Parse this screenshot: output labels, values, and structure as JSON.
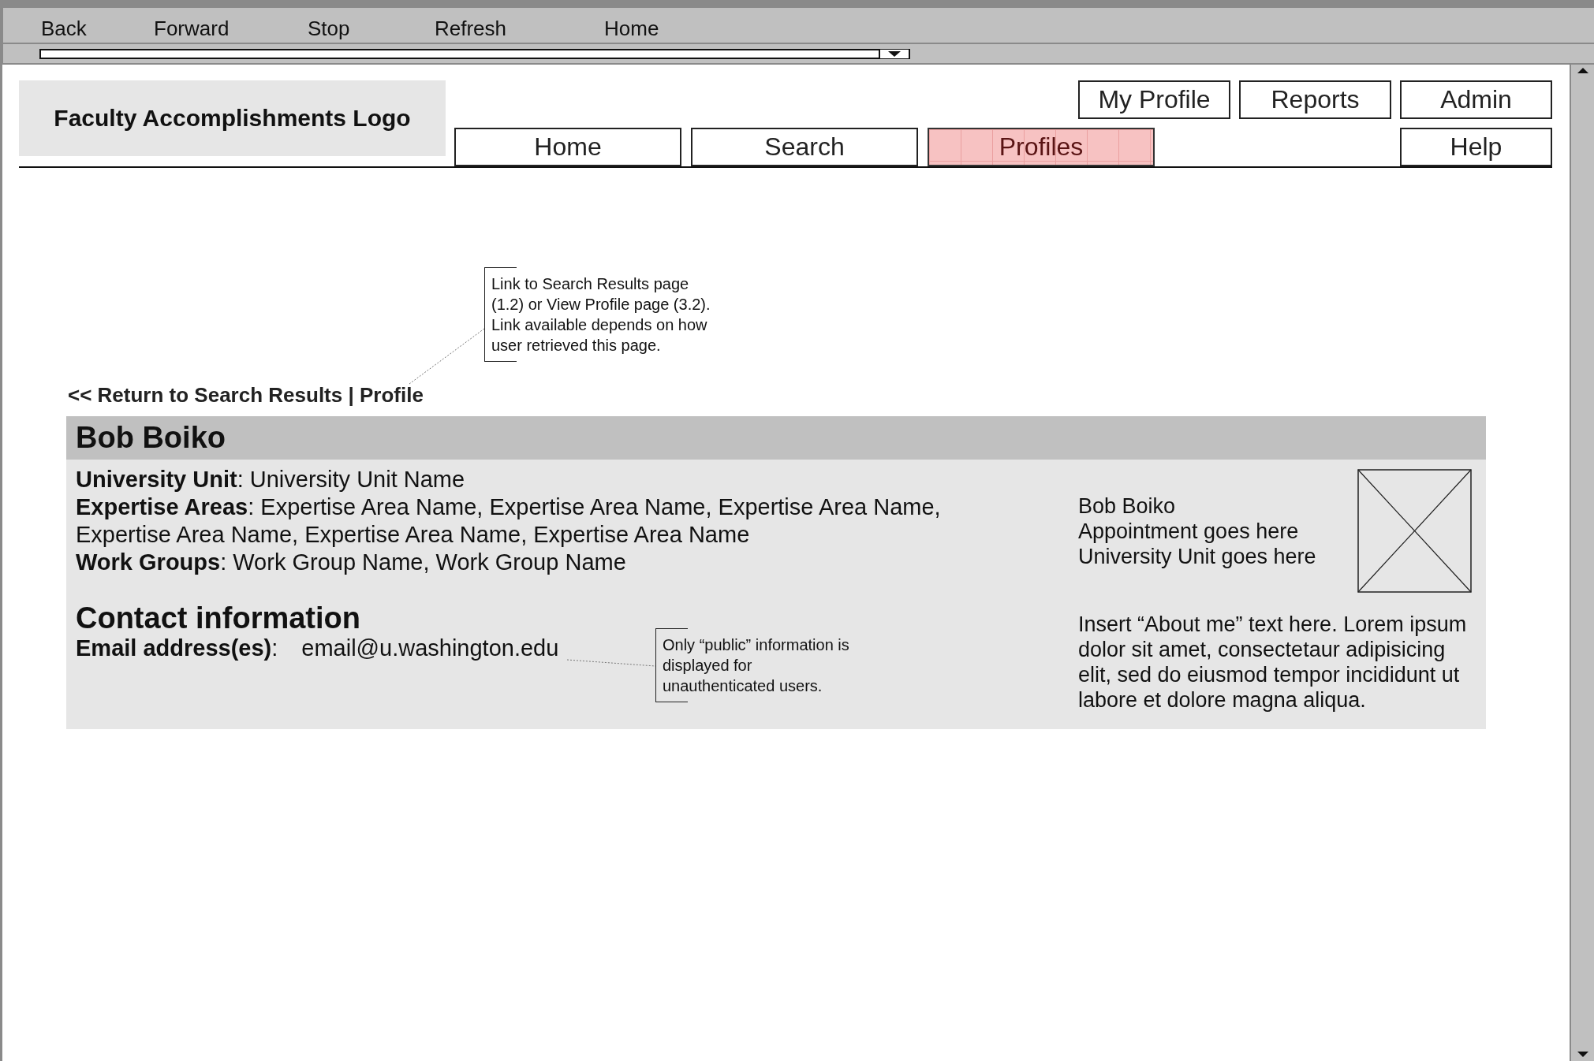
{
  "browser": {
    "buttons": [
      "Back",
      "Forward",
      "Stop",
      "Refresh",
      "Home"
    ]
  },
  "logo": "Faculty Accomplishments Logo",
  "nav_top": [
    {
      "label": "My Profile",
      "selected": false
    },
    {
      "label": "Reports",
      "selected": false
    },
    {
      "label": "Admin",
      "selected": false
    }
  ],
  "nav_main": [
    {
      "label": "Home",
      "selected": false
    },
    {
      "label": "Search",
      "selected": false
    },
    {
      "label": "Profiles",
      "selected": true
    },
    {
      "label": "Help",
      "selected": false
    }
  ],
  "breadcrumb": "<< Return to Search Results | Profile",
  "annotations": [
    {
      "text": "Link to Search Results page (1.2) or View Profile page (3.2). Link available depends on how user retrieved this page."
    },
    {
      "text": "Only “public” information is displayed for unauthenticated users."
    }
  ],
  "profile": {
    "name": "Bob Boiko",
    "fields": [
      "**University Unit**: University Unit Name",
      "**Expertise Areas**: Expertise Area Name, Expertise Area Name, Expertise Area Name, Expertise Area Name, Expertise Area Name, Expertise Area Name",
      "**Work Groups**: Work Group Name, Work Group Name"
    ],
    "contact_heading": "Contact information",
    "email": {
      "label": "**Email address(es)**:",
      "value": "email@u.washington.edu"
    },
    "summary": [
      "Bob Boiko",
      "Appointment goes here",
      "University Unit goes here"
    ],
    "about": "Insert “About me” text here. Lorem ipsum dolor sit amet, consectetaur adipisicing elit, sed do eiusmod tempor incididunt ut labore et dolore magna aliqua."
  }
}
